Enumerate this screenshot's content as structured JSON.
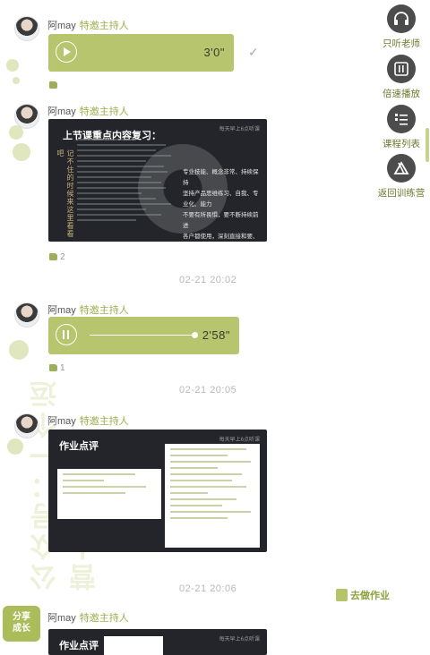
{
  "messages": [
    {
      "author": "阿may",
      "role": "特邀主持人",
      "duration": "3'0\"",
      "likes": ""
    },
    {
      "author": "阿may",
      "role": "特邀主持人",
      "likes": "2",
      "time": "02-21 20:02",
      "slide": {
        "title": "上节课重点内容复习：",
        "brand": "每天早上6点听课",
        "vertical": "记不住的时候来这里看看吧",
        "notes": [
          "专业技能、概念非常、持续保持",
          "坚持产品思维练习、自我、专业化、能力",
          "不要有所畏惧，要不断持续前进",
          "各户都使用，深刻直接和要、积极做"
        ]
      }
    },
    {
      "author": "阿may",
      "role": "特邀主持人",
      "duration": "2'58\"",
      "likes": "1",
      "time": "02-21 20:05"
    },
    {
      "author": "阿may",
      "role": "特邀主持人",
      "time": "02-21 20:06",
      "slide": {
        "title": "作业点评",
        "brand": "每天早上6点听课"
      }
    },
    {
      "author": "阿may",
      "role": "特邀主持人",
      "slide": {
        "title": "作业点评",
        "brand": "每天早上6点听课"
      }
    }
  ],
  "sidebar": [
    {
      "label": "只听老师",
      "icon": "headphones-icon"
    },
    {
      "label": "倍速播放",
      "icon": "speed-icon"
    },
    {
      "label": "课程列表",
      "icon": "list-icon"
    },
    {
      "label": "返回训练营",
      "icon": "back-camp-icon"
    }
  ],
  "homework": "去做作业",
  "badge": "分享\n成长",
  "watermark": "公众号：一个运营人",
  "colors": {
    "accent": "#b7c56f",
    "dark": "#23252a"
  }
}
